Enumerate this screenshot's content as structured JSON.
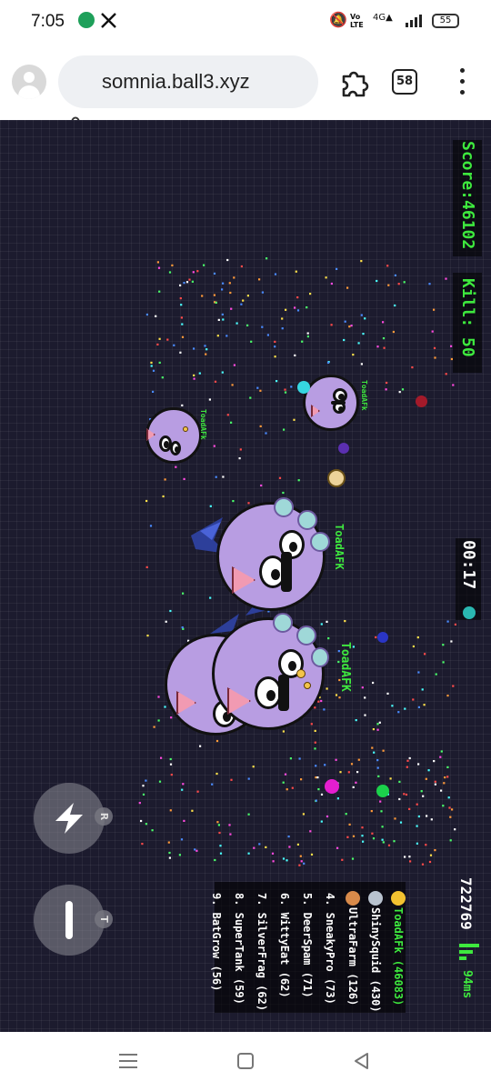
{
  "status_bar": {
    "time": "7:05",
    "battery": "55"
  },
  "browser": {
    "url": "somnia.ball3.xyz",
    "tab_count": "58"
  },
  "game": {
    "score_text": "Score:46102",
    "kill_text": "Kill:  50",
    "timer": "00:17",
    "fps": "722769",
    "ping": "94ms",
    "players": [
      {
        "name": "ToadAFK"
      },
      {
        "name": "ToadAFK"
      },
      {
        "name": "ToadAFk"
      },
      {
        "name": "ToadAFk"
      }
    ],
    "leaderboard": [
      "ToadAFk (46083)",
      "ShinySquid (430)",
      "UltraFarm (126)",
      "4. SneakyPro (73)",
      "5. DeerSpam (71)",
      "6. WittyEat (62)",
      "7. SilverFrag (62)",
      "8. SuperTank (59)",
      "9. BatGrow (56)"
    ],
    "controls": {
      "boost_key": "R",
      "split_key": "T"
    }
  },
  "colors": {
    "background": "#1c1b2e",
    "score_green": "#3ee83e",
    "blob_purple": "#b89de2"
  }
}
